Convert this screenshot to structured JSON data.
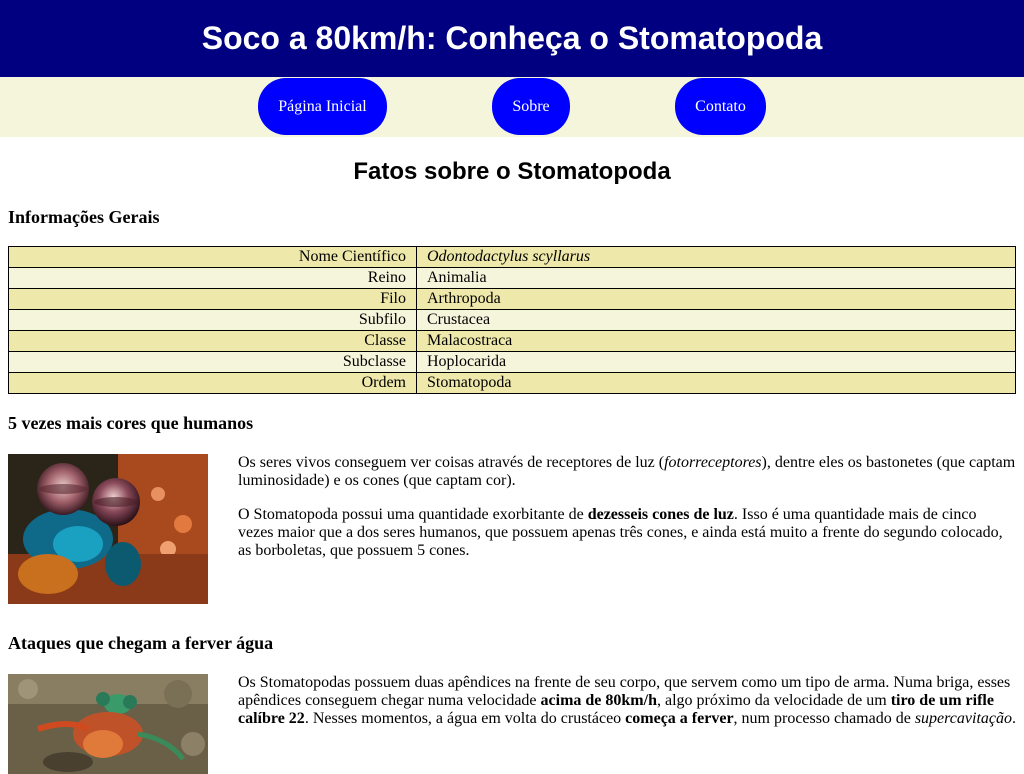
{
  "header": {
    "title": "Soco a 80km/h: Conheça o Stomatopoda"
  },
  "nav": {
    "items": [
      "Página Inicial",
      "Sobre",
      "Contato"
    ]
  },
  "main": {
    "title": "Fatos sobre o Stomatopoda",
    "general": {
      "heading": "Informações Gerais",
      "rows": [
        {
          "key": "Nome Científico",
          "value": "Odontodactylus scyllarus"
        },
        {
          "key": "Reino",
          "value": "Animalia"
        },
        {
          "key": "Filo",
          "value": "Arthropoda"
        },
        {
          "key": "Subfilo",
          "value": "Crustacea"
        },
        {
          "key": "Classe",
          "value": "Malacostraca"
        },
        {
          "key": "Subclasse",
          "value": "Hoplocarida"
        },
        {
          "key": "Ordem",
          "value": "Stomatopoda"
        }
      ]
    },
    "colors": {
      "heading": "5 vezes mais cores que humanos",
      "p1": {
        "a": "Os seres vivos conseguem ver coisas através de receptores de luz (",
        "em": "fotorreceptores",
        "b": "), dentre eles os bastonetes (que captam luminosidade) e os cones (que captam cor)."
      },
      "p2": {
        "a": "O Stomatopoda possui uma quantidade exorbitante de ",
        "strong": "dezesseis cones de luz",
        "b": ". Isso é uma quantidade mais de cinco vezes maior que a dos seres humanos, que possuem apenas três cones, e ainda está muito a frente do segundo colocado, as borboletas, que possuem 5 cones."
      }
    },
    "attack": {
      "heading": "Ataques que chegam a ferver água",
      "p1": {
        "a": "Os Stomatopodas possuem duas apêndices na frente de seu corpo, que servem como um tipo de arma. Numa briga, esses apêndices conseguem chegar numa velocidade ",
        "s1": "acima de 80km/h",
        "b": ", algo próximo da velocidade de um ",
        "s2": "tiro de um rifle calíbre 22",
        "c": ". Nesses momentos, a água em volta do crustáceo ",
        "s3": "começa a ferver",
        "d": ", num processo chamado de ",
        "em": "supercavitação",
        "e": "."
      }
    }
  },
  "colors_theme": {
    "header_bg": "#000080",
    "nav_bg": "#f5f5dc",
    "nav_button": "#0000ff",
    "row_odd": "#eee8aa",
    "row_even": "#f5f5dc"
  }
}
